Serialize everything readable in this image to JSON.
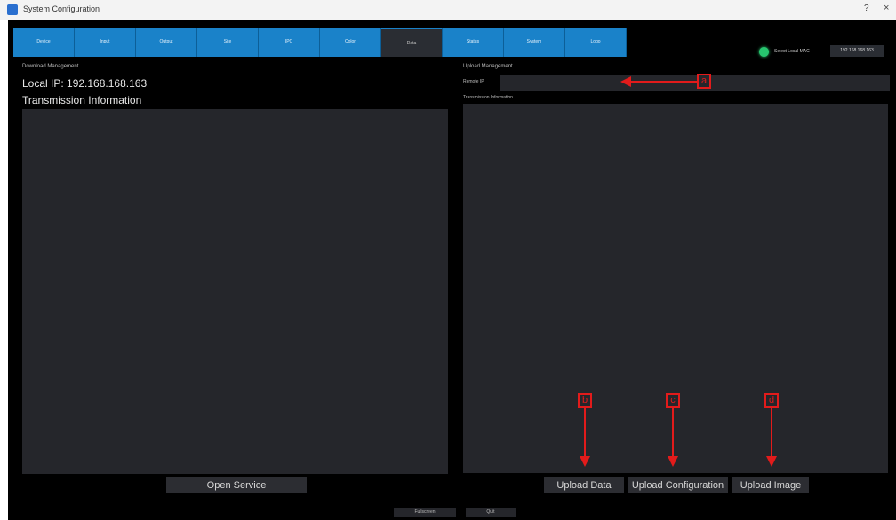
{
  "window": {
    "title": "System Configuration",
    "help": "?",
    "close": "×"
  },
  "tabs": [
    {
      "label": "Device"
    },
    {
      "label": "Input"
    },
    {
      "label": "Output"
    },
    {
      "label": "Site"
    },
    {
      "label": "IPC"
    },
    {
      "label": "Color"
    },
    {
      "label": "Data",
      "active": true
    },
    {
      "label": "Status"
    },
    {
      "label": "System"
    },
    {
      "label": "Logo"
    }
  ],
  "network": {
    "select_local_mac_label": "Select Local MAC",
    "mac_value": "192.168.168.163",
    "status_color": "#27c56f"
  },
  "download": {
    "section_label": "Download Management",
    "local_ip": "Local IP: 192.168.168.163",
    "transmission_label": "Transmission Information",
    "open_service_label": "Open Service"
  },
  "upload": {
    "section_label": "Upload Management",
    "remote_ip_label": "Remote IP",
    "remote_ip_value": "",
    "transmission_label": "Transmission Information",
    "upload_data_label": "Upload Data",
    "upload_configuration_label": "Upload Configuration",
    "upload_image_label": "Upload Image"
  },
  "footer": {
    "fullscreen_label": "Fullscreen",
    "quit_label": "Quit"
  },
  "annotations": {
    "a": "a",
    "b": "b",
    "c": "c",
    "d": "d",
    "color": "#e21b1b"
  },
  "colors": {
    "tab_blue": "#1a82c9",
    "panel": "#25262b",
    "background": "#000000"
  }
}
